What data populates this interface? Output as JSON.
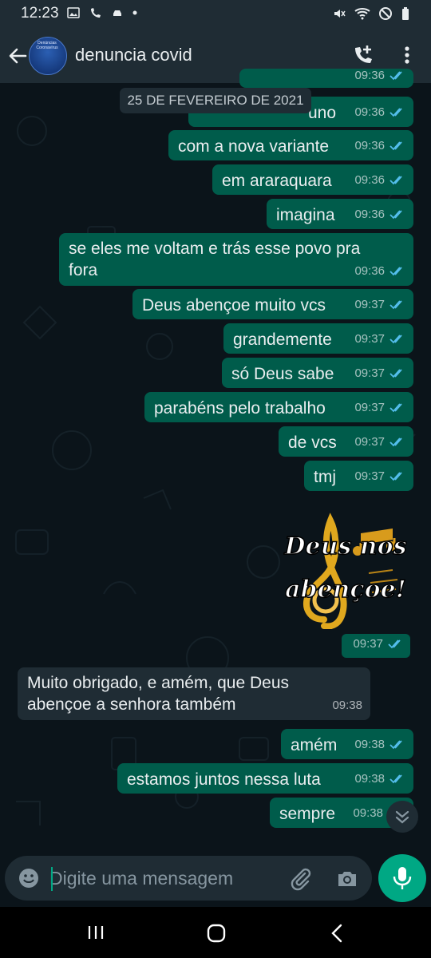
{
  "status_bar": {
    "time": "12:23"
  },
  "header": {
    "contact_name": "denuncia covid",
    "avatar_text": "Denúncias Coronavírus"
  },
  "date_badge": "25 DE FEVEREIRO DE 2021",
  "messages": [
    {
      "text": "",
      "time": "09:36",
      "direction": "out"
    },
    {
      "text": "uno",
      "time": "09:36",
      "direction": "out"
    },
    {
      "text": "com a nova variante",
      "time": "09:36",
      "direction": "out"
    },
    {
      "text": "em araraquara",
      "time": "09:36",
      "direction": "out"
    },
    {
      "text": "imagina",
      "time": "09:36",
      "direction": "out"
    },
    {
      "text_line1": "se eles me voltam e trás esse povo pra",
      "text_line2": "fora",
      "time": "09:36",
      "direction": "out"
    },
    {
      "text": "Deus abençoe muito vcs",
      "time": "09:37",
      "direction": "out"
    },
    {
      "text": "grandemente",
      "time": "09:37",
      "direction": "out"
    },
    {
      "text": "só Deus sabe",
      "time": "09:37",
      "direction": "out"
    },
    {
      "text": "parabéns pelo trabalho",
      "time": "09:37",
      "direction": "out"
    },
    {
      "text": "de vcs",
      "time": "09:37",
      "direction": "out"
    },
    {
      "text": "tmj",
      "time": "09:37",
      "direction": "out"
    },
    {
      "text": "",
      "time": "09:37",
      "direction": "out"
    },
    {
      "text_line1": "Muito obrigado, e amém, que Deus",
      "text_line2": "abençoe a senhora também",
      "time": "09:38",
      "direction": "in"
    },
    {
      "text": "amém",
      "time": "09:38",
      "direction": "out"
    },
    {
      "text": "estamos juntos nessa luta",
      "time": "09:38",
      "direction": "out"
    },
    {
      "text": "sempre",
      "time": "09:38",
      "direction": "out"
    }
  ],
  "sticker": {
    "line1": "Deus nos",
    "line2": "abençoe!"
  },
  "composer": {
    "placeholder": "Digite uma mensagem"
  },
  "colors": {
    "outgoing_bubble": "#005c4b",
    "incoming_bubble": "#1f2c34",
    "accent": "#00a884",
    "read_tick": "#53bdeb"
  },
  "icons": [
    "arrow-back-icon",
    "add-call-icon",
    "more-vert-icon",
    "emoji-icon",
    "attach-icon",
    "camera-icon",
    "mic-icon",
    "scroll-down-icon"
  ]
}
